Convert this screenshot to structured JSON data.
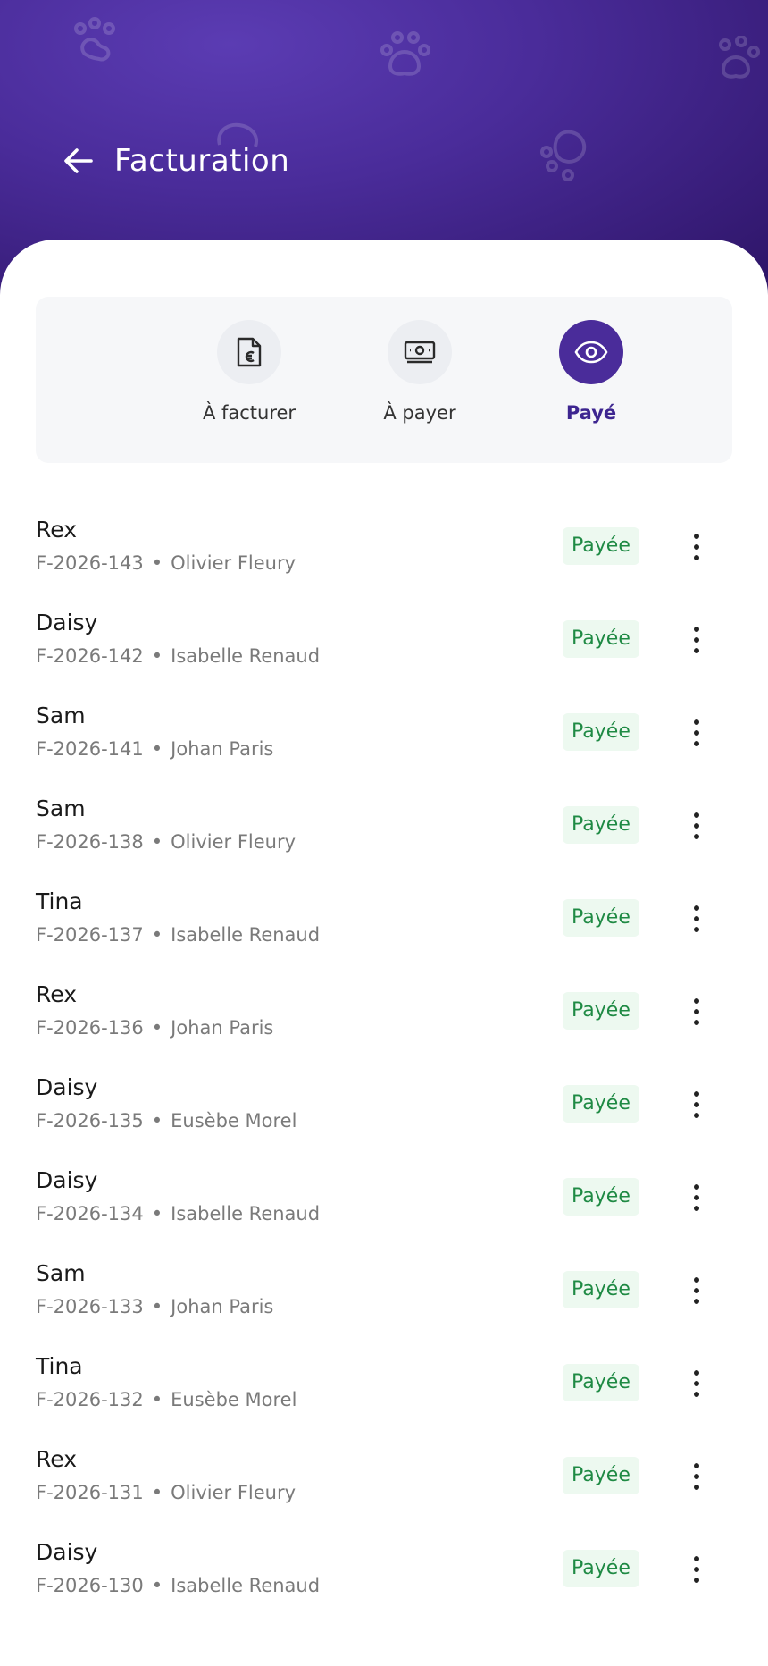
{
  "header": {
    "title": "Facturation",
    "back_icon": "arrow-left-icon",
    "decoration_icon": "paw-icon"
  },
  "tabs": [
    {
      "label": "À facturer",
      "icon": "invoice-euro-icon",
      "active": false
    },
    {
      "label": "À payer",
      "icon": "banknote-icon",
      "active": false
    },
    {
      "label": "Payé",
      "icon": "eye-icon",
      "active": true
    }
  ],
  "invoices": [
    {
      "name": "Rex",
      "number": "F-2026-143",
      "owner": "Olivier Fleury",
      "status": "Payée"
    },
    {
      "name": "Daisy",
      "number": "F-2026-142",
      "owner": "Isabelle Renaud",
      "status": "Payée"
    },
    {
      "name": "Sam",
      "number": "F-2026-141",
      "owner": "Johan Paris",
      "status": "Payée"
    },
    {
      "name": "Sam",
      "number": "F-2026-138",
      "owner": "Olivier Fleury",
      "status": "Payée"
    },
    {
      "name": "Tina",
      "number": "F-2026-137",
      "owner": "Isabelle Renaud",
      "status": "Payée"
    },
    {
      "name": "Rex",
      "number": "F-2026-136",
      "owner": "Johan Paris",
      "status": "Payée"
    },
    {
      "name": "Daisy",
      "number": "F-2026-135",
      "owner": "Eusèbe Morel",
      "status": "Payée"
    },
    {
      "name": "Daisy",
      "number": "F-2026-134",
      "owner": "Isabelle Renaud",
      "status": "Payée"
    },
    {
      "name": "Sam",
      "number": "F-2026-133",
      "owner": "Johan Paris",
      "status": "Payée"
    },
    {
      "name": "Tina",
      "number": "F-2026-132",
      "owner": "Eusèbe Morel",
      "status": "Payée"
    },
    {
      "name": "Rex",
      "number": "F-2026-131",
      "owner": "Olivier Fleury",
      "status": "Payée"
    },
    {
      "name": "Daisy",
      "number": "F-2026-130",
      "owner": "Isabelle Renaud",
      "status": "Payée"
    }
  ],
  "separator": "•",
  "more_icon": "more-vertical-icon",
  "colors": {
    "header_primary": "#4a2c9a",
    "header_dark": "#2d1466",
    "active_tab": "#4a2c9a",
    "badge_bg": "#edf9f0",
    "badge_text": "#1f8a44"
  }
}
